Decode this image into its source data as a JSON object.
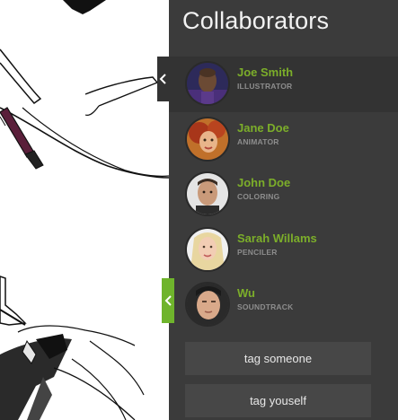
{
  "panel": {
    "title": "Collaborators",
    "collaborators": [
      {
        "name": "Joe Smith",
        "role": "ILLUSTRATOR",
        "avatar": "avatar-joe-smith",
        "active": true
      },
      {
        "name": "Jane Doe",
        "role": "ANIMATOR",
        "avatar": "avatar-jane-doe",
        "active": false
      },
      {
        "name": "John Doe",
        "role": "COLORING",
        "avatar": "avatar-john-doe",
        "active": false
      },
      {
        "name": "Sarah Willams",
        "role": "PENCILER",
        "avatar": "avatar-sarah-willams",
        "active": false
      },
      {
        "name": "Wu",
        "role": "SOUNDTRACK",
        "avatar": "avatar-wu",
        "active": false
      }
    ],
    "buttons": {
      "tag_someone": "tag someone",
      "tag_youself": "tag youself"
    }
  },
  "tabs": {
    "collapse_icon": "chevron-left-icon",
    "expand_icon": "chevron-left-icon"
  },
  "colors": {
    "panel_bg": "#3b3b3b",
    "name_green": "#7cae2a",
    "tab_green": "#6fb42c",
    "button_bg": "#474747"
  }
}
